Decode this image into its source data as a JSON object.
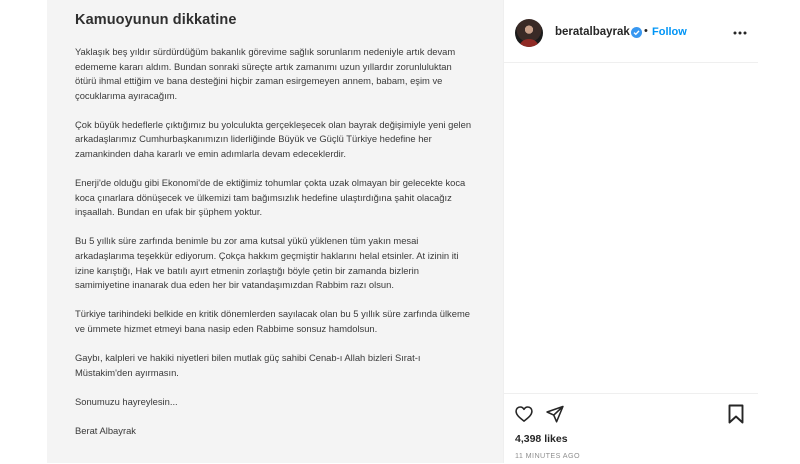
{
  "notice": {
    "title": "Kamuoyunun dikkatine",
    "paragraphs": [
      "Yaklaşık beş yıldır sürdürdüğüm bakanlık görevime sağlık sorunlarım nedeniyle artık devam edememe kararı aldım. Bundan sonraki süreçte artık zamanımı uzun yıllardır zorunluluktan ötürü ihmal ettiğim ve bana desteğini hiçbir zaman esirgemeyen annem, babam, eşim ve çocuklarıma ayıracağım.",
      "Çok büyük hedeflerle çıktığımız bu yolculukta gerçekleşecek olan bayrak değişimiyle yeni gelen arkadaşlarımız Cumhurbaşkanımızın liderliğinde Büyük ve Güçlü Türkiye hedefine her zamankinden daha kararlı ve emin adımlarla devam edeceklerdir.",
      "Enerji'de olduğu gibi Ekonomi'de de ektiğimiz tohumlar çokta uzak olmayan bir gelecekte koca koca çınarlara dönüşecek ve ülkemizi tam bağımsızlık hedefine ulaştırdığına şahit olacağız inşaallah. Bundan en ufak bir şüphem yoktur.",
      "Bu 5 yıllık süre zarfında benimle bu zor ama kutsal yükü yüklenen tüm yakın mesai arkadaşlarıma teşekkür ediyorum. Çokça hakkım geçmiştir haklarını helal etsinler. At izinin iti izine karıştığı, Hak ve batılı ayırt etmenin zorlaştığı böyle çetin bir zamanda bizlerin samimiyetine inanarak dua eden her bir vatandaşımızdan Rabbim razı olsun.",
      "Türkiye tarihindeki belkide en kritik dönemlerden sayılacak olan bu 5 yıllık süre zarfında ülkeme ve ümmete hizmet etmeyi bana nasip eden Rabbime sonsuz hamdolsun.",
      "Gaybı, kalpleri ve hakiki niyetleri bilen mutlak güç sahibi Cenab-ı Allah bizleri Sırat-ı Müstakim'den ayırmasın.",
      "Sonumuzu hayreylesin...",
      "Berat Albayrak"
    ]
  },
  "header": {
    "username": "beratalbayrak",
    "separator": "•",
    "follow_label": "Follow"
  },
  "post": {
    "likes": "4,398 likes",
    "timestamp": "11 MINUTES AGO"
  },
  "icons": {
    "avatar": "profile-photo",
    "verified": "verified-badge-icon",
    "more": "more-options-icon",
    "like": "heart-icon",
    "share": "paper-plane-icon",
    "save": "bookmark-icon"
  },
  "colors": {
    "accent": "#0095f6",
    "verified": "#3897f0",
    "text": "#262626",
    "muted": "#8e8e8e",
    "image_background": "#f4f4f4"
  }
}
